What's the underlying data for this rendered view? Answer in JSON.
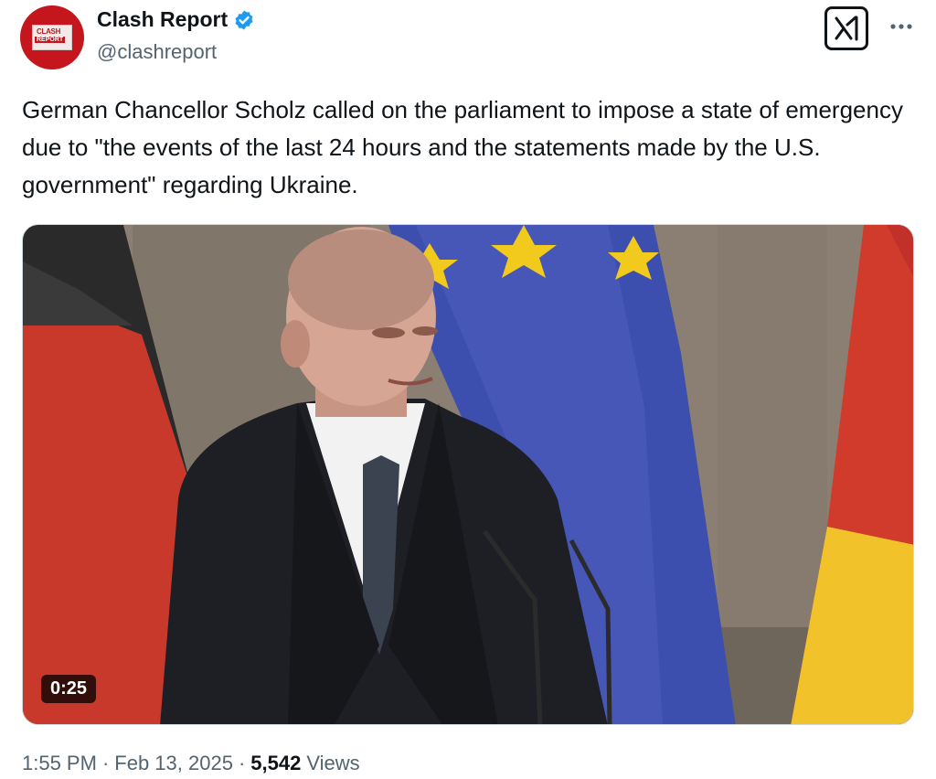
{
  "author": {
    "display_name": "Clash Report",
    "handle": "@clashreport",
    "avatar_text_top": "CLASH",
    "avatar_text_bottom": "REPORT",
    "verified_color": "#1d9bf0",
    "avatar_color": "#c4161c"
  },
  "tweet": {
    "text": "German Chancellor Scholz called on the parliament to impose a state of emergency due to \"the events of the last 24 hours and the statements made by the U.S. government\" regarding Ukraine."
  },
  "media": {
    "type": "video",
    "duration": "0:25"
  },
  "meta": {
    "time": "1:55 PM",
    "date": "Feb 13, 2025",
    "views_count": "5,542",
    "views_label": "Views"
  },
  "icons": {
    "verified": "verified-badge-icon",
    "grok": "grok-icon",
    "more": "more-icon"
  }
}
